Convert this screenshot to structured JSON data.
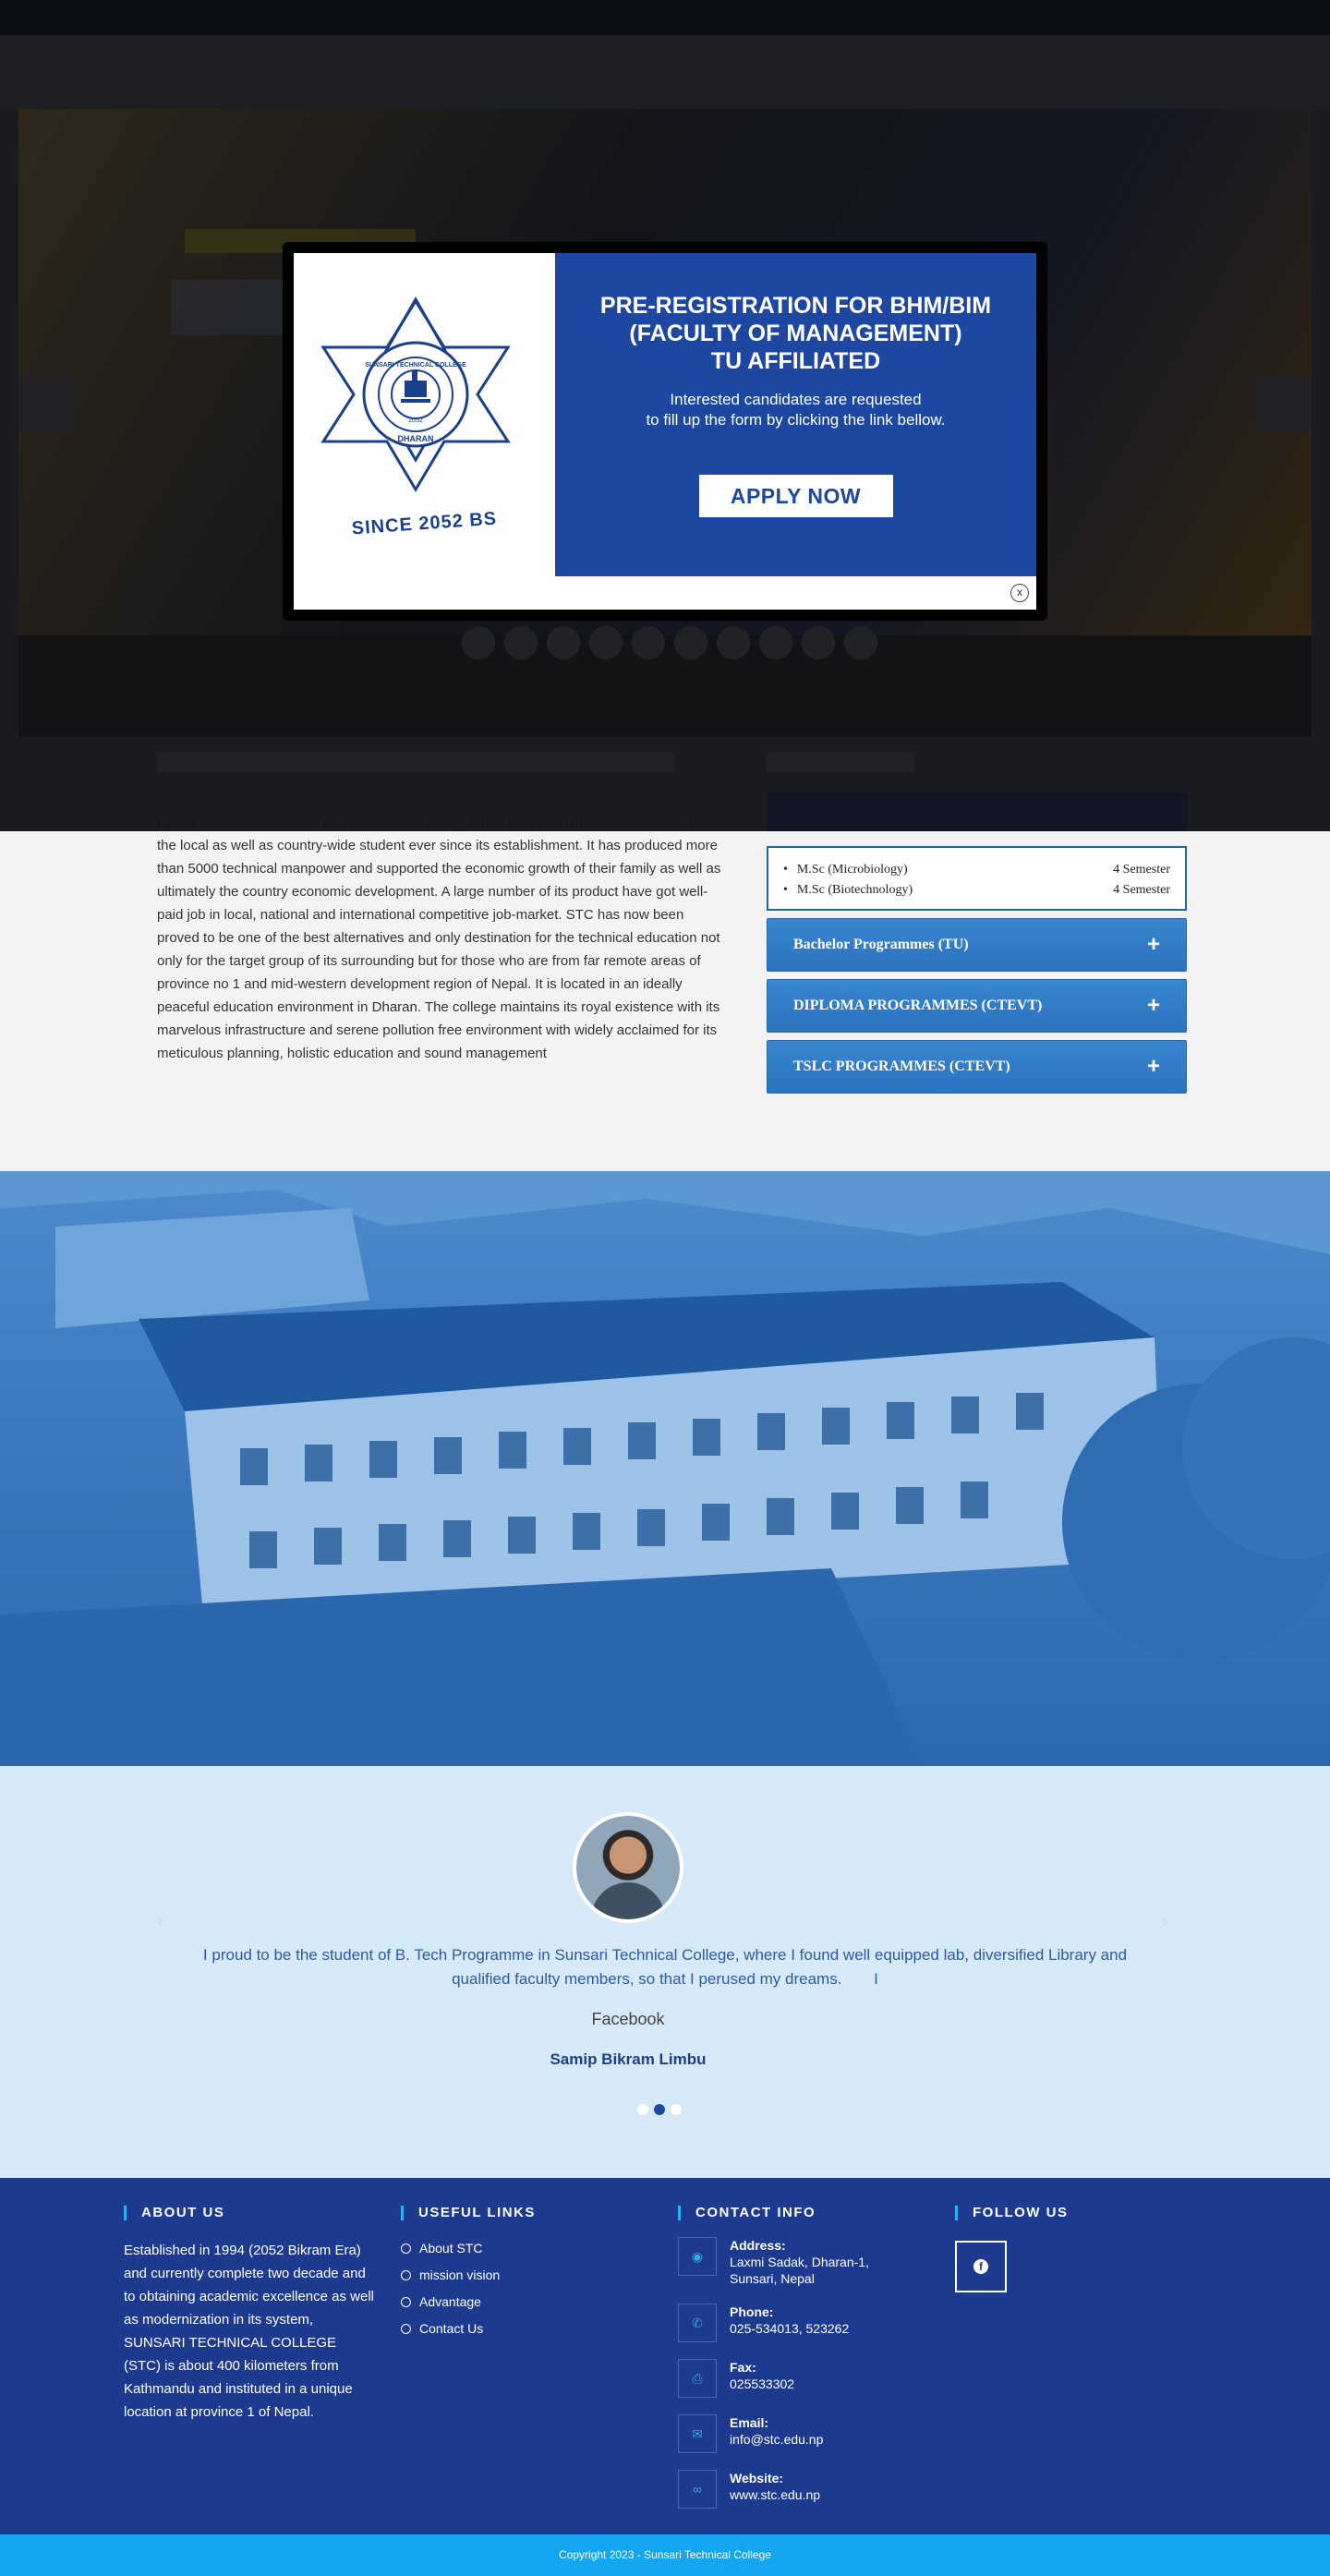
{
  "popup": {
    "logo_ring_text": "SUNSARI TECHNICAL COLLEGE",
    "logo_city": "DHARAN",
    "logo_year": "2052",
    "logo_since": "SINCE 2052 BS",
    "title_lines": [
      "PRE-REGISTRATION FOR BHM/BIM",
      "(FACULTY OF MANAGEMENT)",
      "TU AFFILIATED"
    ],
    "subtitle_lines": [
      "Interested candidates are requested",
      "to fill up the form by clicking the link bellow."
    ],
    "apply_label": "APPLY NOW",
    "close_label": "x"
  },
  "about": {
    "paragraph": "quality technical education and vocational training. It has now been the best destination for the local as well as country-wide student ever since its establishment. It has produced more than 5000 technical manpower and supported the economic growth of their family as well as ultimately the country economic development. A large number of its product have got well-paid job in local, national and international competitive job-market. STC has now been proved to be one of the best alternatives and only destination for the technical education not only for the target group of its surrounding but for those who are from far remote areas of province no 1 and mid-western development region of Nepal. It is located in an ideally peaceful education environment in Dharan. The college maintains its royal existence with its marvelous infrastructure and serene pollution free environment with widely acclaimed for its meticulous planning, holistic education and sound management"
  },
  "programmes": {
    "open_items": [
      {
        "name": "M.Sc (Microbiology)",
        "duration": "4 Semester"
      },
      {
        "name": "M.Sc (Biotechnology)",
        "duration": "4 Semester"
      }
    ],
    "accordions": [
      {
        "label": "Bachelor Programmes (TU)",
        "icon": "+"
      },
      {
        "label": "DIPLOMA PROGRAMMES (CTEVT)",
        "icon": "+"
      },
      {
        "label": "TSLC PROGRAMMES (CTEVT)",
        "icon": "+"
      }
    ]
  },
  "testimonial": {
    "quote": "I proud to be the student of B. Tech Programme in Sunsari Technical College, where I found well equipped lab, diversified Library and qualified faculty members, so that I perused my dreams.",
    "quote_mark": "I",
    "source": "Facebook",
    "name": "Samip Bikram Limbu",
    "active_slide": 2,
    "slide_count": 3
  },
  "footer": {
    "about": {
      "heading": "ABOUT US",
      "text": "Established in 1994 (2052 Bikram Era) and currently complete two decade and to obtaining academic excellence as well as modernization in its system, SUNSARI TECHNICAL COLLEGE (STC) is about 400 kilometers from Kathmandu and instituted in a unique location at province 1 of Nepal."
    },
    "links": {
      "heading": "USEFUL LINKS",
      "items": [
        "About STC",
        "mission vision",
        "Advantage",
        "Contact Us"
      ]
    },
    "contact": {
      "heading": "CONTACT INFO",
      "items": [
        {
          "icon": "map-pin-icon",
          "label": "Address:",
          "value": "Laxmi Sadak, Dharan-1, Sunsari, Nepal"
        },
        {
          "icon": "phone-icon",
          "label": "Phone:",
          "value": "025-534013, 523262"
        },
        {
          "icon": "fax-icon",
          "label": "Fax:",
          "value": "025533302"
        },
        {
          "icon": "mail-icon",
          "label": "Email:",
          "value": "info@stc.edu.np"
        },
        {
          "icon": "link-icon",
          "label": "Website:",
          "value": "www.stc.edu.np"
        }
      ]
    },
    "follow": {
      "heading": "FOLLOW US",
      "icon_glyph": "f"
    },
    "copyright": "Copyright 2023 - Sunsari Technical College"
  },
  "colors": {
    "brand_blue": "#1d47a0",
    "footer_blue": "#1e3a8f",
    "accent_cyan": "#14a6f0",
    "accordion_blue": "#2a73bf"
  }
}
